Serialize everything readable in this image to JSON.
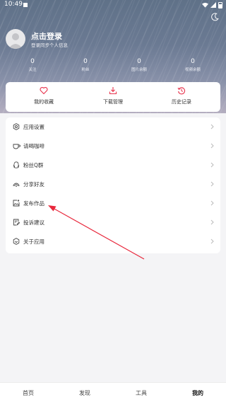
{
  "status_bar": {
    "time": "10:49"
  },
  "profile": {
    "login_title": "点击登录",
    "login_subtitle": "登录同步个人信息",
    "stats": [
      {
        "value": "0",
        "label": "关注"
      },
      {
        "value": "0",
        "label": "粉丝"
      },
      {
        "value": "0",
        "label": "图片余额"
      },
      {
        "value": "0",
        "label": "视频余额"
      }
    ]
  },
  "quick_actions": [
    {
      "label": "我的收藏",
      "icon": "heart-icon"
    },
    {
      "label": "下载管理",
      "icon": "download-icon"
    },
    {
      "label": "历史记录",
      "icon": "history-icon"
    }
  ],
  "menu": [
    {
      "label": "应用设置",
      "icon": "gear-icon"
    },
    {
      "label": "请喝咖啡",
      "icon": "coffee-icon"
    },
    {
      "label": "粉丝Q群",
      "icon": "qq-icon"
    },
    {
      "label": "分享好友",
      "icon": "share-icon"
    },
    {
      "label": "发布作品",
      "icon": "image-upload-icon"
    },
    {
      "label": "投诉建议",
      "icon": "feedback-icon"
    },
    {
      "label": "关于应用",
      "icon": "about-icon"
    }
  ],
  "tabs": [
    {
      "label": "首页",
      "active": false
    },
    {
      "label": "发现",
      "active": false
    },
    {
      "label": "工具",
      "active": false
    },
    {
      "label": "我的",
      "active": true
    }
  ],
  "colors": {
    "accent": "#e8344e",
    "annotation_arrow": "#e8283c"
  }
}
